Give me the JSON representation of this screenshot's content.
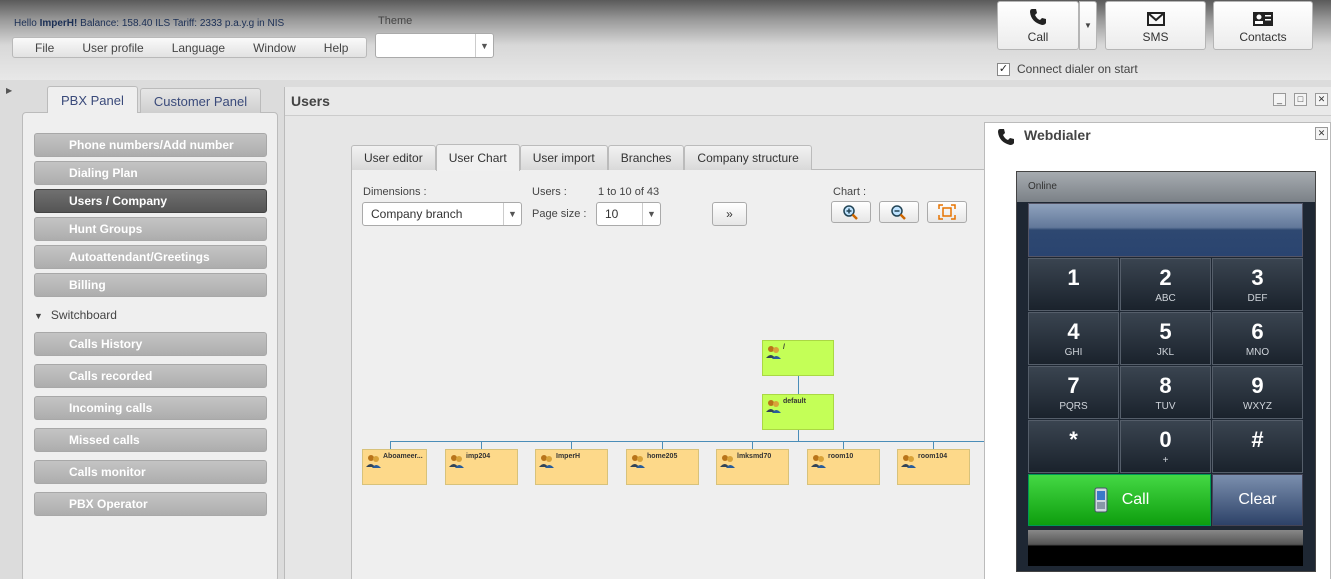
{
  "header": {
    "greeting_prefix": "Hello",
    "greeting_user": "ImperH!",
    "greeting_rest": "Balance: 158.40 ILS Tariff: 2333 p.a.y.g in NIS",
    "menu": [
      "File",
      "User profile",
      "Language",
      "Window",
      "Help"
    ],
    "theme_label": "Theme",
    "theme_value": "",
    "call_label": "Call",
    "sms_label": "SMS",
    "contacts_label": "Contacts",
    "connect_dialer_label": "Connect dialer on start",
    "connect_dialer_checked": true
  },
  "left_panel": {
    "tabs": [
      "PBX Panel",
      "Customer Panel"
    ],
    "nav_top": [
      "Phone numbers/Add number",
      "Dialing Plan",
      "Users / Company",
      "Hunt Groups",
      "Autoattendant/Greetings",
      "Billing"
    ],
    "active_item": "Users / Company",
    "section": "Switchboard",
    "nav_switchboard": [
      "Calls History",
      "Calls recorded",
      "Incoming calls",
      "Missed calls",
      "Calls monitor",
      "PBX Operator"
    ]
  },
  "users_window": {
    "title": "Users",
    "tabs": [
      "User editor",
      "User Chart",
      "User import",
      "Branches",
      "Company structure"
    ],
    "active_tab": "User Chart",
    "dimensions_label": "Dimensions :",
    "dimensions_value": "Company branch",
    "users_label": "Users :",
    "users_range": "1 to 10 of 43",
    "page_size_label": "Page size :",
    "page_size_value": "10",
    "next_label": "»",
    "chart_label": "Chart :",
    "org_root": "/",
    "org_mid": "default",
    "org_leaves": [
      "Aboameer...",
      "imp204",
      "ImperH",
      "home205",
      "lmksmd70",
      "room10",
      "room104"
    ]
  },
  "webdialer": {
    "title": "Webdialer",
    "status": "Online",
    "keys": [
      {
        "d": "1",
        "l": ""
      },
      {
        "d": "2",
        "l": "ABC"
      },
      {
        "d": "3",
        "l": "DEF"
      },
      {
        "d": "4",
        "l": "GHI"
      },
      {
        "d": "5",
        "l": "JKL"
      },
      {
        "d": "6",
        "l": "MNO"
      },
      {
        "d": "7",
        "l": "PQRS"
      },
      {
        "d": "8",
        "l": "TUV"
      },
      {
        "d": "9",
        "l": "WXYZ"
      },
      {
        "d": "*",
        "l": ""
      },
      {
        "d": "0",
        "l": "+"
      },
      {
        "d": "#",
        "l": ""
      }
    ],
    "call_label": "Call",
    "clear_label": "Clear"
  }
}
